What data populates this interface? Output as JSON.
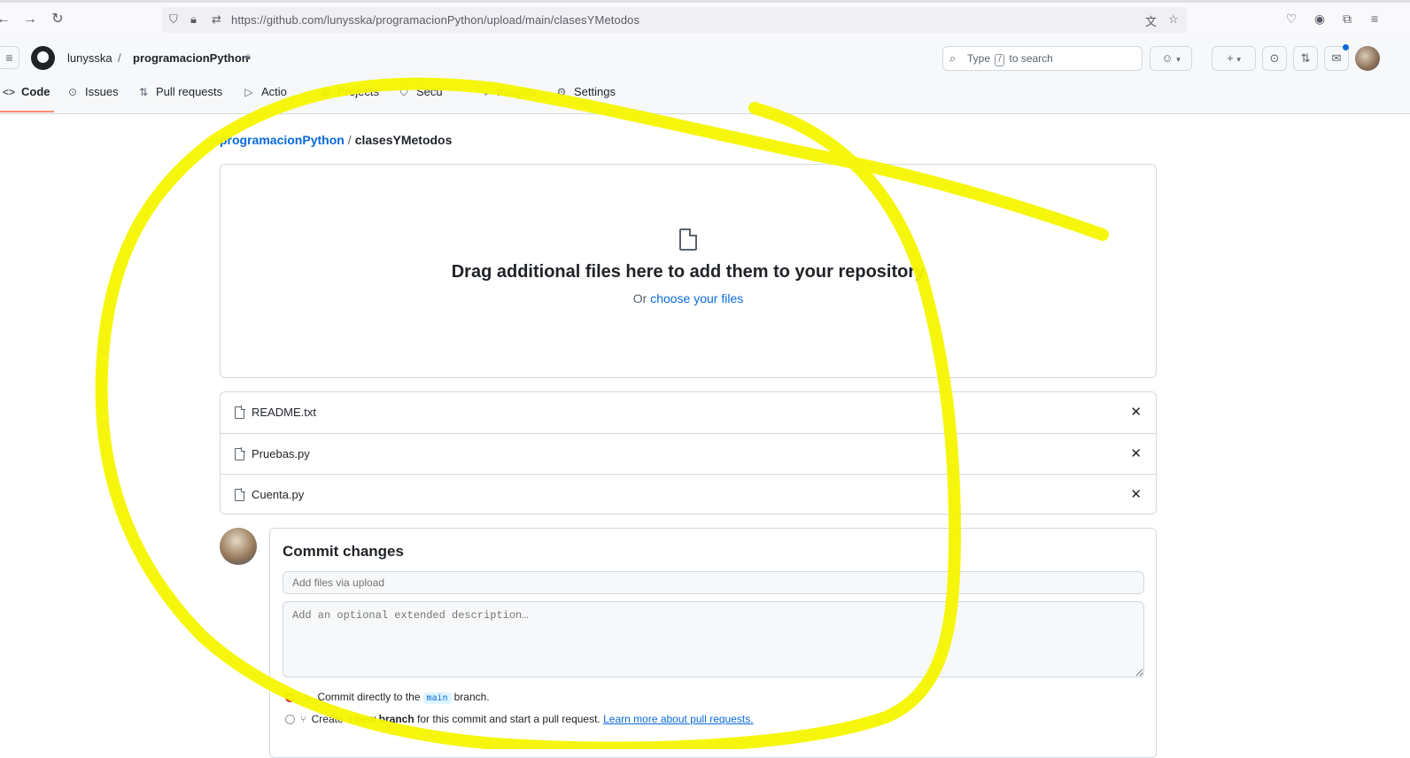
{
  "browser": {
    "url": "https://github.com/lunysska/programacionPython/upload/main/clasesYMetodos",
    "back_icon": "arrow-left-icon",
    "forward_icon": "arrow-right-icon",
    "reload_icon": "reload-icon"
  },
  "header": {
    "owner": "lunysska",
    "separator": "/",
    "repo": "programacionPython",
    "search_prefix": "Type",
    "search_key": "/",
    "search_suffix": "to search"
  },
  "tabs": [
    {
      "label": "Code",
      "icon": "code-icon"
    },
    {
      "label": "Issues",
      "icon": "issue-icon"
    },
    {
      "label": "Pull requests",
      "icon": "pull-request-icon"
    },
    {
      "label": "Actio",
      "icon": "play-icon"
    },
    {
      "label": "Projects",
      "icon": "table-icon"
    },
    {
      "label": "Secu",
      "icon": "shield-icon"
    },
    {
      "label": "Insights",
      "icon": "graph-icon"
    },
    {
      "label": "Settings",
      "icon": "gear-icon"
    }
  ],
  "breadcrumb": {
    "repo_link": "programacionPython",
    "separator": "/",
    "current": "clasesYMetodos"
  },
  "dropzone": {
    "title": "Drag additional files here to add them to your repository",
    "or_text": "Or",
    "link_text": "choose your files"
  },
  "files": [
    {
      "name": "README.txt"
    },
    {
      "name": "Pruebas.py"
    },
    {
      "name": "Cuenta.py"
    }
  ],
  "commit": {
    "title": "Commit changes",
    "summary_placeholder": "Add files via upload",
    "description_placeholder": "Add an optional extended description…",
    "option_direct_prefix": "Commit directly to the",
    "branch_name": "main",
    "option_direct_suffix": "branch.",
    "option_new_prefix": "Create a",
    "option_new_bold": "new branch",
    "option_new_suffix": "for this commit and start a pull request.",
    "learn_more": "Learn more about pull requests."
  },
  "colors": {
    "link": "#0969da",
    "tab_underline": "#fd8c73",
    "annotation": "#f5f500"
  }
}
